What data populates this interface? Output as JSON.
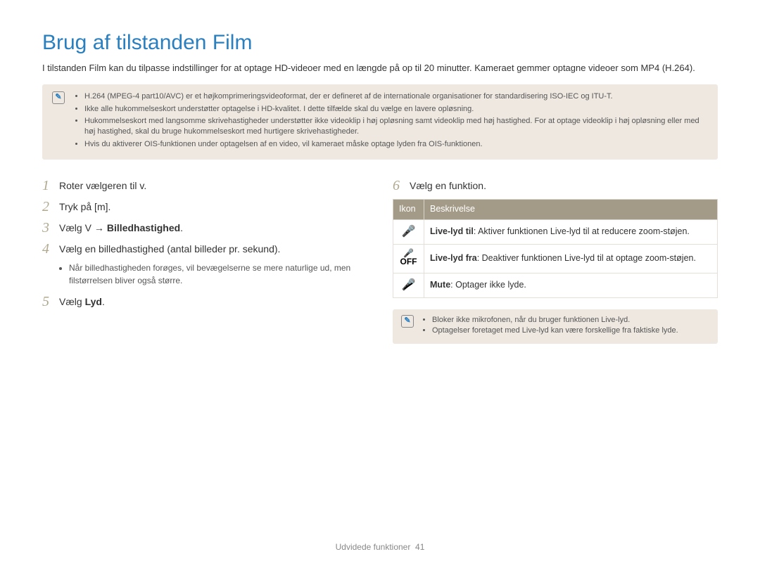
{
  "title": "Brug af tilstanden Film",
  "intro": "I tilstanden Film kan du tilpasse indstillinger for at optage HD-videoer med en længde på op til 20 minutter. Kameraet gemmer optagne videoer som MP4 (H.264).",
  "top_note": {
    "items": [
      "H.264 (MPEG-4 part10/AVC) er et højkomprimeringsvideoformat, der er defineret af de internationale organisationer for standardisering ISO-IEC og ITU-T.",
      "Ikke alle hukommelseskort understøtter optagelse i HD-kvalitet. I dette tilfælde skal du vælge en lavere opløsning.",
      "Hukommelseskort med langsomme skrivehastigheder understøtter ikke videoklip i høj opløsning samt videoklip med høj hastighed. For at optage videoklip i høj opløsning eller med høj hastighed, skal du bruge hukommelseskort med hurtigere skrivehastigheder.",
      "Hvis du aktiverer OIS-funktionen under optagelsen af en video, vil kameraet måske optage lyden fra OIS-funktionen."
    ]
  },
  "steps_left": {
    "s1": {
      "num": "1",
      "text_a": "Roter vælgeren til ",
      "text_b": "v",
      "text_c": "."
    },
    "s2": {
      "num": "2",
      "text_a": "Tryk på [",
      "text_b": "m",
      "text_c": "]."
    },
    "s3": {
      "num": "3",
      "text_a": "Vælg ",
      "text_b": "V",
      "arrow": "→",
      "bold": "Billedhastighed",
      "text_c": "."
    },
    "s4": {
      "num": "4",
      "text": "Vælg en billedhastighed (antal billeder pr. sekund).",
      "sub": "Når billedhastigheden forøges, vil bevægelserne se mere naturlige ud, men filstørrelsen bliver også større."
    },
    "s5": {
      "num": "5",
      "text_a": "Vælg ",
      "bold": "Lyd",
      "text_c": "."
    }
  },
  "steps_right": {
    "s6": {
      "num": "6",
      "text": "Vælg en funktion."
    }
  },
  "table": {
    "head_icon": "Ikon",
    "head_desc": "Beskrivelse",
    "rows": [
      {
        "icon": "mic",
        "bold": "Live-lyd til",
        "rest": ": Aktiver funktionen Live-lyd til at reducere zoom-støjen."
      },
      {
        "icon": "mic-off",
        "bold": "Live-lyd fra",
        "rest": ": Deaktiver funktionen Live-lyd til at optage zoom-støjen."
      },
      {
        "icon": "mic-mute",
        "bold": "Mute",
        "rest": ": Optager ikke lyde."
      }
    ]
  },
  "right_note": {
    "items": [
      "Bloker ikke mikrofonen, når du bruger funktionen Live-lyd.",
      "Optagelser foretaget med Live-lyd kan være forskellige fra faktiske lyde."
    ]
  },
  "footer": {
    "label": "Udvidede funktioner",
    "page": "41"
  }
}
